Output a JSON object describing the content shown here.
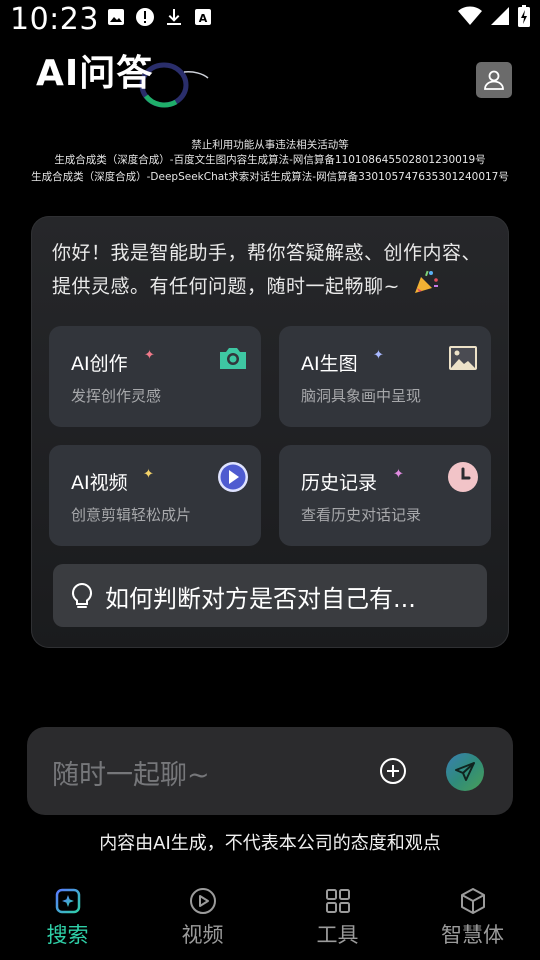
{
  "status_bar": {
    "time": "10:23"
  },
  "header": {
    "logo_text": "AI问答"
  },
  "notice": {
    "line1": "禁止利用功能从事违法相关活动等",
    "line2": "生成合成类（深度合成）-百度文生图内容生成算法-网信算备110108645502801230019号",
    "line3": "生成合成类（深度合成）-DeepSeekChat求索对话生成算法-网信算备330105747635301240017号"
  },
  "greeting": "你好！我是智能助手，帮你答疑解惑、创作内容、提供灵感。有任何问题，随时一起畅聊~",
  "features": [
    {
      "title": "AI创作",
      "desc": "发挥创作灵感",
      "icon": "camera-icon",
      "sparkle_color": "#f07a8a"
    },
    {
      "title": "AI生图",
      "desc": "脑洞具象画中呈现",
      "icon": "image-icon",
      "sparkle_color": "#a8b8ff"
    },
    {
      "title": "AI视频",
      "desc": "创意剪辑轻松成片",
      "icon": "play-icon",
      "sparkle_color": "#f4d36a"
    },
    {
      "title": "历史记录",
      "desc": "查看历史对话记录",
      "icon": "clock-icon",
      "sparkle_color": "#e08be0"
    }
  ],
  "suggested_question": "如何判断对方是否对自己有...",
  "input": {
    "placeholder": "随时一起聊~"
  },
  "disclaimer": "内容由AI生成，不代表本公司的态度和观点",
  "nav": [
    {
      "label": "搜索",
      "icon": "search-sparkle-icon",
      "active": true
    },
    {
      "label": "视频",
      "icon": "play-circle-icon",
      "active": false
    },
    {
      "label": "工具",
      "icon": "grid-icon",
      "active": false
    },
    {
      "label": "智慧体",
      "icon": "cube-icon",
      "active": false
    }
  ],
  "colors": {
    "accent": "#2fd0a8",
    "background": "#000000",
    "card": "#32353b"
  }
}
